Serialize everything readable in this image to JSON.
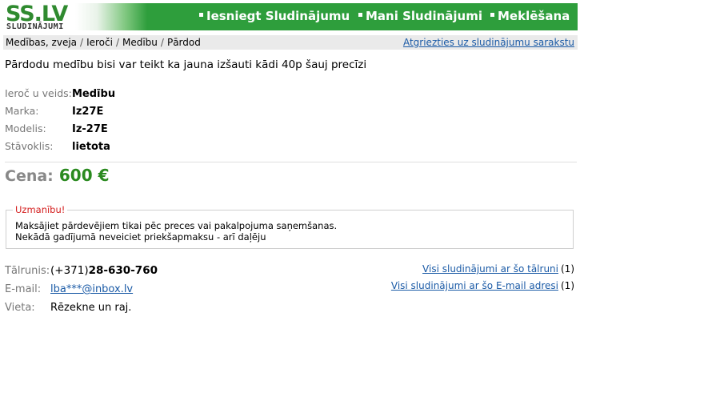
{
  "header": {
    "logo": "SS.LV",
    "logo_sub": "SLUDINĀJUMI",
    "nav": [
      {
        "label": "Iesniegt Sludinājumu"
      },
      {
        "label": "Mani Sludinājumi"
      },
      {
        "label": "Meklēšana"
      }
    ]
  },
  "breadcrumb": {
    "items": [
      "Medības, zveja",
      "Ieroči",
      "Medību",
      "Pārdod"
    ],
    "separator": "/",
    "back_link": "Atgriezties uz sludinājumu sarakstu"
  },
  "ad": {
    "description": "Pārdodu medību bisi var teikt ka jauna izšauti kādi 40p šauj precīzi",
    "specs": [
      {
        "label": "Ieroč u veids:",
        "value": "Medību"
      },
      {
        "label": "Marka:",
        "value": "Iz27E"
      },
      {
        "label": "Modelis:",
        "value": "Iz-27E"
      },
      {
        "label": "Stāvoklis:",
        "value": "lietota"
      }
    ],
    "price_label": "Cena:",
    "price_value": "600 €"
  },
  "warning": {
    "title": "Uzmanību!",
    "line1": "Maksājiet pārdevējiem tikai pēc preces vai pakalpojuma saņemšanas.",
    "line2": "Nekādā gadījumā neveiciet priekšapmaksu - arī daļēju"
  },
  "contacts": {
    "phone_label": "Tālrunis:",
    "phone_prefix": "(+371)",
    "phone_number": "28-630-760",
    "email_label": "E-mail:",
    "email_value": "lba***@inbox.lv",
    "location_label": "Vieta:",
    "location_value": "Rēzekne un raj."
  },
  "related": {
    "by_phone": {
      "label": "Visi sludinājumi ar šo tālruni",
      "count": "(1)"
    },
    "by_email": {
      "label": "Visi sludinājumi ar šo E-mail adresi",
      "count": "(1)"
    }
  },
  "colors": {
    "brand_green": "#2e9e3c",
    "price_green": "#2a8a1f",
    "link_blue": "#1a5aa6",
    "warning_red": "#d42020"
  }
}
